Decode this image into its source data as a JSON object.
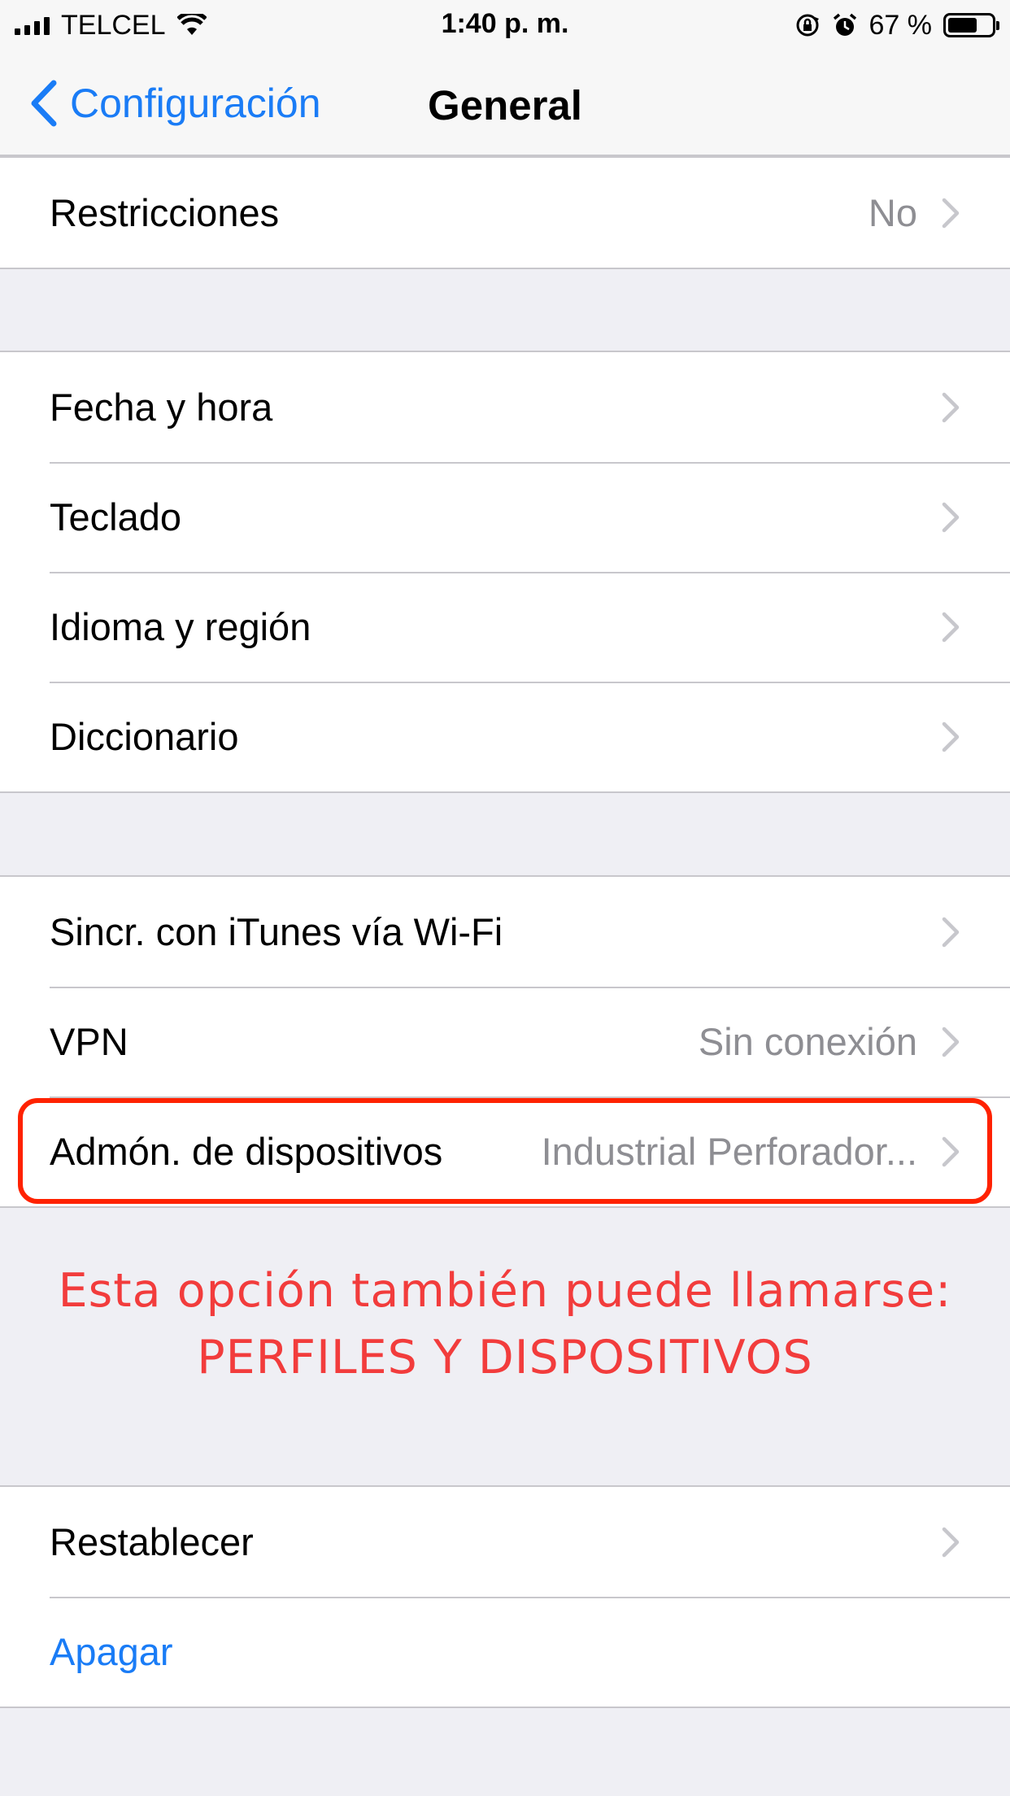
{
  "status_bar": {
    "carrier": "TELCEL",
    "time": "1:40 p. m.",
    "battery_percent": "67 %",
    "battery_level": 0.67,
    "icons": [
      "signal-icon",
      "wifi-icon",
      "orientation-lock-icon",
      "alarm-icon",
      "battery-icon"
    ]
  },
  "navbar": {
    "back_label": "Configuración",
    "title": "General"
  },
  "groups": [
    {
      "rows": [
        {
          "label": "Restricciones",
          "value": "No"
        }
      ]
    },
    {
      "rows": [
        {
          "label": "Fecha y hora",
          "value": ""
        },
        {
          "label": "Teclado",
          "value": ""
        },
        {
          "label": "Idioma y región",
          "value": ""
        },
        {
          "label": "Diccionario",
          "value": ""
        }
      ]
    },
    {
      "rows": [
        {
          "label": "Sincr. con iTunes vía Wi-Fi",
          "value": ""
        },
        {
          "label": "VPN",
          "value": "Sin conexión"
        },
        {
          "label": "Admón. de dispositivos",
          "value": "Industrial Perforador..."
        }
      ]
    },
    {
      "rows": [
        {
          "label": "Restablecer",
          "value": ""
        },
        {
          "label": "Apagar",
          "value": ""
        }
      ]
    }
  ],
  "annotation": {
    "line1": "Esta opción también puede llamarse:",
    "line2": "PERFILES Y DISPOSITIVOS"
  },
  "colors": {
    "accent": "#1a7cf6",
    "highlight": "#ff2200",
    "annotation": "#f23c3c",
    "background": "#efeff4",
    "secondary_text": "#8e8e93"
  }
}
